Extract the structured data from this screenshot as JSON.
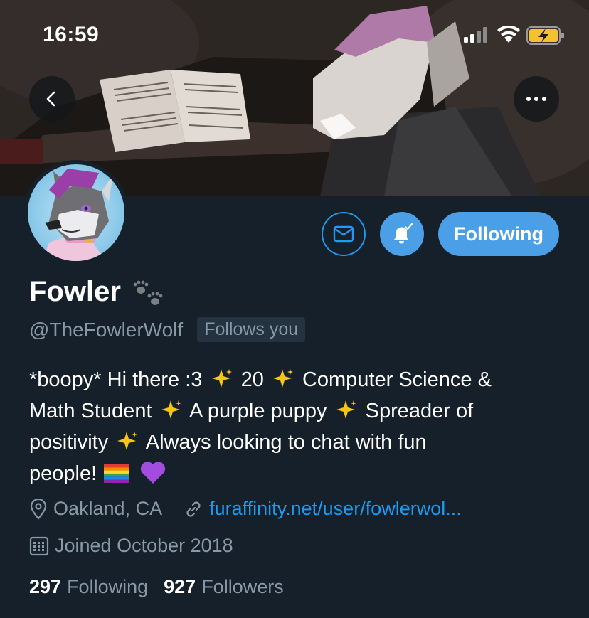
{
  "status_bar": {
    "time": "16:59"
  },
  "icons": {
    "back": "chevron-left-icon",
    "more": "more-horizontal-icon",
    "message": "envelope-icon",
    "notify": "bell-check-icon",
    "location": "location-pin-icon",
    "link": "link-icon",
    "calendar": "calendar-icon"
  },
  "profile": {
    "display_name": "Fowler",
    "handle": "@TheFowlerWolf",
    "follows_you": "Follows you",
    "follow_button": "Following",
    "bio": {
      "line1_a": "*boopy* Hi there :3",
      "line1_b": "20",
      "line1_c": "Computer Science &",
      "line2_a": "Math Student",
      "line2_b": "A purple puppy",
      "line2_c": "Spreader of",
      "line3_a": "positivity",
      "line3_b": "Always looking to chat with fun",
      "line4_a": "people!"
    },
    "location": "Oakland, CA",
    "website": "furaffinity.net/user/fowlerwol...",
    "joined": "Joined October 2018",
    "following_count": "297",
    "following_label": "Following",
    "followers_count": "927",
    "followers_label": "Followers"
  },
  "colors": {
    "background": "#15202b",
    "accent": "#1d9bf0",
    "button_fill": "#4a9fe6",
    "secondary_text": "#8899a6"
  }
}
